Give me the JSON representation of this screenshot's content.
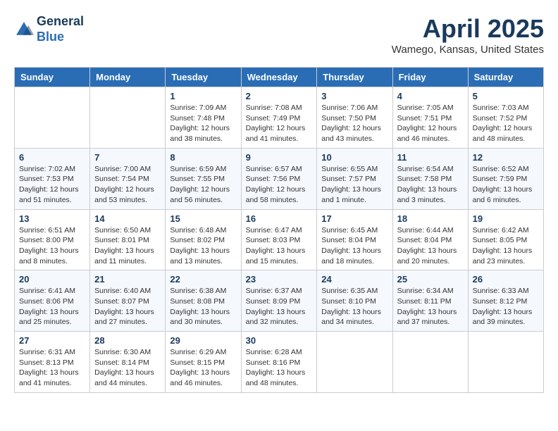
{
  "header": {
    "logo_line1": "General",
    "logo_line2": "Blue",
    "title": "April 2025",
    "subtitle": "Wamego, Kansas, United States"
  },
  "weekdays": [
    "Sunday",
    "Monday",
    "Tuesday",
    "Wednesday",
    "Thursday",
    "Friday",
    "Saturday"
  ],
  "weeks": [
    [
      {
        "day": "",
        "info": ""
      },
      {
        "day": "",
        "info": ""
      },
      {
        "day": "1",
        "info": "Sunrise: 7:09 AM\nSunset: 7:48 PM\nDaylight: 12 hours and 38 minutes."
      },
      {
        "day": "2",
        "info": "Sunrise: 7:08 AM\nSunset: 7:49 PM\nDaylight: 12 hours and 41 minutes."
      },
      {
        "day": "3",
        "info": "Sunrise: 7:06 AM\nSunset: 7:50 PM\nDaylight: 12 hours and 43 minutes."
      },
      {
        "day": "4",
        "info": "Sunrise: 7:05 AM\nSunset: 7:51 PM\nDaylight: 12 hours and 46 minutes."
      },
      {
        "day": "5",
        "info": "Sunrise: 7:03 AM\nSunset: 7:52 PM\nDaylight: 12 hours and 48 minutes."
      }
    ],
    [
      {
        "day": "6",
        "info": "Sunrise: 7:02 AM\nSunset: 7:53 PM\nDaylight: 12 hours and 51 minutes."
      },
      {
        "day": "7",
        "info": "Sunrise: 7:00 AM\nSunset: 7:54 PM\nDaylight: 12 hours and 53 minutes."
      },
      {
        "day": "8",
        "info": "Sunrise: 6:59 AM\nSunset: 7:55 PM\nDaylight: 12 hours and 56 minutes."
      },
      {
        "day": "9",
        "info": "Sunrise: 6:57 AM\nSunset: 7:56 PM\nDaylight: 12 hours and 58 minutes."
      },
      {
        "day": "10",
        "info": "Sunrise: 6:55 AM\nSunset: 7:57 PM\nDaylight: 13 hours and 1 minute."
      },
      {
        "day": "11",
        "info": "Sunrise: 6:54 AM\nSunset: 7:58 PM\nDaylight: 13 hours and 3 minutes."
      },
      {
        "day": "12",
        "info": "Sunrise: 6:52 AM\nSunset: 7:59 PM\nDaylight: 13 hours and 6 minutes."
      }
    ],
    [
      {
        "day": "13",
        "info": "Sunrise: 6:51 AM\nSunset: 8:00 PM\nDaylight: 13 hours and 8 minutes."
      },
      {
        "day": "14",
        "info": "Sunrise: 6:50 AM\nSunset: 8:01 PM\nDaylight: 13 hours and 11 minutes."
      },
      {
        "day": "15",
        "info": "Sunrise: 6:48 AM\nSunset: 8:02 PM\nDaylight: 13 hours and 13 minutes."
      },
      {
        "day": "16",
        "info": "Sunrise: 6:47 AM\nSunset: 8:03 PM\nDaylight: 13 hours and 15 minutes."
      },
      {
        "day": "17",
        "info": "Sunrise: 6:45 AM\nSunset: 8:04 PM\nDaylight: 13 hours and 18 minutes."
      },
      {
        "day": "18",
        "info": "Sunrise: 6:44 AM\nSunset: 8:04 PM\nDaylight: 13 hours and 20 minutes."
      },
      {
        "day": "19",
        "info": "Sunrise: 6:42 AM\nSunset: 8:05 PM\nDaylight: 13 hours and 23 minutes."
      }
    ],
    [
      {
        "day": "20",
        "info": "Sunrise: 6:41 AM\nSunset: 8:06 PM\nDaylight: 13 hours and 25 minutes."
      },
      {
        "day": "21",
        "info": "Sunrise: 6:40 AM\nSunset: 8:07 PM\nDaylight: 13 hours and 27 minutes."
      },
      {
        "day": "22",
        "info": "Sunrise: 6:38 AM\nSunset: 8:08 PM\nDaylight: 13 hours and 30 minutes."
      },
      {
        "day": "23",
        "info": "Sunrise: 6:37 AM\nSunset: 8:09 PM\nDaylight: 13 hours and 32 minutes."
      },
      {
        "day": "24",
        "info": "Sunrise: 6:35 AM\nSunset: 8:10 PM\nDaylight: 13 hours and 34 minutes."
      },
      {
        "day": "25",
        "info": "Sunrise: 6:34 AM\nSunset: 8:11 PM\nDaylight: 13 hours and 37 minutes."
      },
      {
        "day": "26",
        "info": "Sunrise: 6:33 AM\nSunset: 8:12 PM\nDaylight: 13 hours and 39 minutes."
      }
    ],
    [
      {
        "day": "27",
        "info": "Sunrise: 6:31 AM\nSunset: 8:13 PM\nDaylight: 13 hours and 41 minutes."
      },
      {
        "day": "28",
        "info": "Sunrise: 6:30 AM\nSunset: 8:14 PM\nDaylight: 13 hours and 44 minutes."
      },
      {
        "day": "29",
        "info": "Sunrise: 6:29 AM\nSunset: 8:15 PM\nDaylight: 13 hours and 46 minutes."
      },
      {
        "day": "30",
        "info": "Sunrise: 6:28 AM\nSunset: 8:16 PM\nDaylight: 13 hours and 48 minutes."
      },
      {
        "day": "",
        "info": ""
      },
      {
        "day": "",
        "info": ""
      },
      {
        "day": "",
        "info": ""
      }
    ]
  ]
}
